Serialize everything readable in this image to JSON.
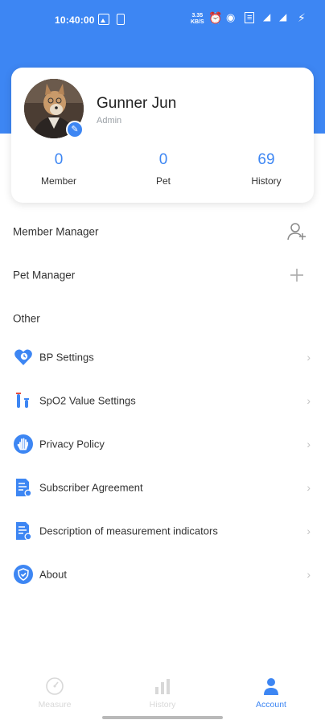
{
  "status_bar": {
    "time": "10:40:00",
    "net_speed_value": "3.35",
    "net_speed_unit": "KB/S",
    "icons": [
      "image-icon",
      "phone-icon",
      "alarm-icon",
      "hotspot-icon",
      "volte-icon",
      "signal-icon",
      "signal-4g-icon",
      "battery-charging-icon"
    ]
  },
  "profile": {
    "name": "Gunner Jun",
    "role": "Admin",
    "stats": [
      {
        "value": "0",
        "label": "Member"
      },
      {
        "value": "0",
        "label": "Pet"
      },
      {
        "value": "69",
        "label": "History"
      }
    ]
  },
  "menu": {
    "member_manager": "Member Manager",
    "pet_manager": "Pet Manager",
    "other_header": "Other",
    "items": [
      {
        "label": "BP Settings",
        "icon": "heart-bp-icon"
      },
      {
        "label": "SpO2 Value Settings",
        "icon": "test-tube-icon"
      },
      {
        "label": "Privacy Policy",
        "icon": "hand-icon"
      },
      {
        "label": "Subscriber Agreement",
        "icon": "document-icon"
      },
      {
        "label": "Description of measurement indicators",
        "icon": "document-icon"
      },
      {
        "label": "About",
        "icon": "shield-icon"
      }
    ]
  },
  "bottom_nav": {
    "tabs": [
      {
        "label": "Measure",
        "icon": "gauge-icon",
        "active": false
      },
      {
        "label": "History",
        "icon": "bar-chart-icon",
        "active": false
      },
      {
        "label": "Account",
        "icon": "person-icon",
        "active": true
      }
    ]
  },
  "colors": {
    "accent": "#3d86f3",
    "inactive": "#d8d8d8",
    "chevron": "#c4c4c4"
  }
}
